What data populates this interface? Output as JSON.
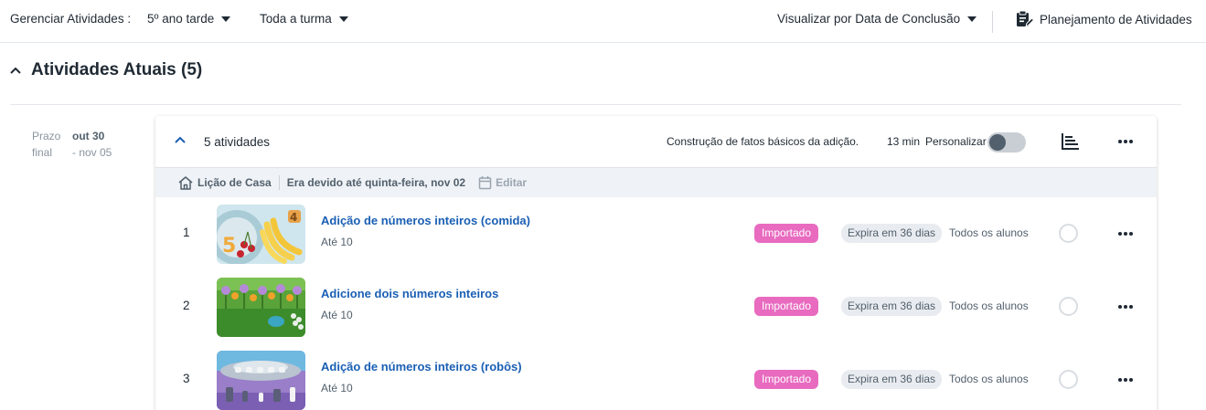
{
  "topbar": {
    "label": "Gerenciar Atividades :",
    "class_select": "5º ano tarde",
    "group_select": "Toda a turma",
    "view_select": "Visualizar por Data de Conclusão",
    "planning": "Planejamento de Atividades"
  },
  "section": {
    "title": "Atividades Atuais (5)"
  },
  "dates": {
    "label1": "Prazo",
    "label2": "final",
    "start": "out 30",
    "end": "- nov 05"
  },
  "card": {
    "count": "5 atividades",
    "description": "Construção de fatos básicos da adição.",
    "time": "13 min",
    "personalize": "Personalizar",
    "personalize_on": false,
    "homework": "Lição de Casa",
    "due": "Era devido até quinta-feira, nov 02",
    "edit": "Editar"
  },
  "activities": [
    {
      "num": "1",
      "title": "Adição de números inteiros (comida)",
      "sub": "Até 10",
      "tag": "Importado",
      "expiry": "Expira em 36 dias",
      "who": "Todos os alunos"
    },
    {
      "num": "2",
      "title": "Adicione dois números inteiros",
      "sub": "Até 10",
      "tag": "Importado",
      "expiry": "Expira em 36 dias",
      "who": "Todos os alunos"
    },
    {
      "num": "3",
      "title": "Adição de números inteiros (robôs)",
      "sub": "Até 10",
      "tag": "Importado",
      "expiry": "Expira em 36 dias",
      "who": "Todos os alunos"
    }
  ],
  "colors": {
    "link": "#1a5fb4",
    "badge_imported": "#e86bc0",
    "badge_expiry_bg": "#e8ebef"
  }
}
